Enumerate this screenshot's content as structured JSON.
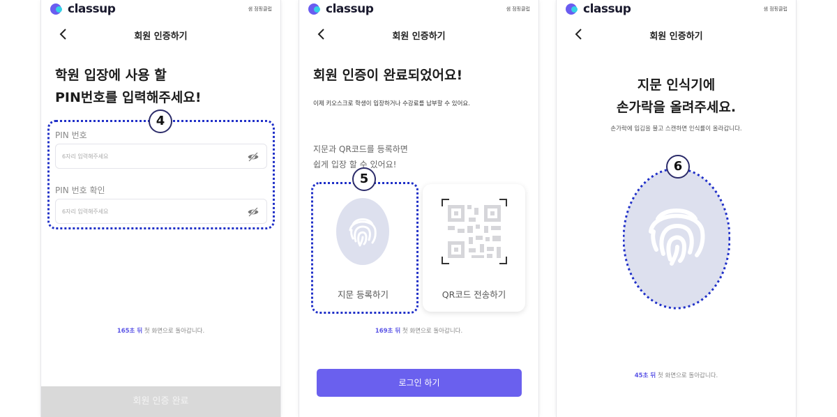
{
  "brand": {
    "name": "classup",
    "small_text": "샘 점핑클럽"
  },
  "nav": {
    "title": "회원 인증하기"
  },
  "screen1": {
    "heading_line1": "학원 입장에 사용 할",
    "heading_line2": "PIN번호를 입력해주세요!",
    "badge": "4",
    "pin_label": "PIN 번호",
    "pin_placeholder": "6자리 입력해주세요",
    "pin_confirm_label": "PIN 번호 확인",
    "pin_confirm_placeholder": "6자리 입력해주세요",
    "timer_seconds": "165초 뒤",
    "timer_text": " 첫 화면으로 돌아갑니다.",
    "submit_label": "회원 인증 완료"
  },
  "screen2": {
    "heading": "회원 인증이 완료되었어요!",
    "subtext": "이제 키오스크로 학생이 입장하거나 수강료를 납부할 수 있어요.",
    "prompt_line1": "지문과 QR코드를 등록하면",
    "prompt_line2": "쉽게 입장 할 수 있어요!",
    "badge": "5",
    "fingerprint_card_label": "지문 등록하기",
    "qr_card_label": "QR코드 전송하기",
    "timer_seconds": "169초 뒤",
    "timer_text": " 첫 화면으로 돌아갑니다.",
    "login_label": "로그인 하기"
  },
  "screen3": {
    "heading_line1": "지문 인식기에",
    "heading_line2": "손가락을 올려주세요.",
    "subtext": "손가락에 입김을 불고 스캔하면 인식률이 올라갑니다.",
    "badge": "6",
    "timer_seconds": "45초 뒤",
    "timer_text": " 첫 화면으로 돌아갑니다."
  },
  "colors": {
    "accent": "#6a60ee",
    "highlight_dotted": "#2030c8",
    "fingerprint_bg": "#dde0ee",
    "disabled_button": "#d9d9d9"
  }
}
